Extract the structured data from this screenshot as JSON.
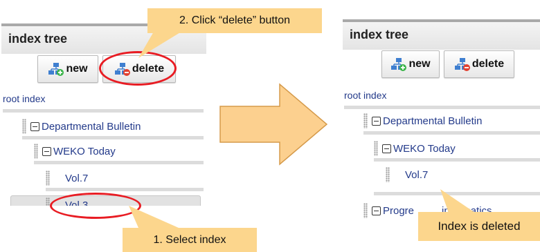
{
  "left_panel": {
    "header_title": "index tree",
    "new_button": "new",
    "delete_button": "delete",
    "root_link": "root index",
    "tree": [
      {
        "label": "Departmental Bulletin"
      },
      {
        "label": "WEKO Today"
      },
      {
        "label": "Vol.7"
      },
      {
        "label": "Vol.3",
        "selected": true
      }
    ]
  },
  "right_panel": {
    "header_title": "index tree",
    "new_button": "new",
    "delete_button": "delete",
    "root_link": "root index",
    "tree": [
      {
        "label": "Departmental Bulletin"
      },
      {
        "label": "WEKO Today"
      },
      {
        "label": "Vol.7"
      },
      {
        "label": "Progre",
        "label_end": "informatics"
      }
    ]
  },
  "callouts": {
    "step1": "1. Select index",
    "step2": "2. Click “delete” button",
    "result": "Index is deleted"
  },
  "colors": {
    "callout_fill": "#fcd68d",
    "arrow_fill": "#fcd08f",
    "highlight_oval": "#e81c23",
    "tree_link": "#233a8a"
  }
}
